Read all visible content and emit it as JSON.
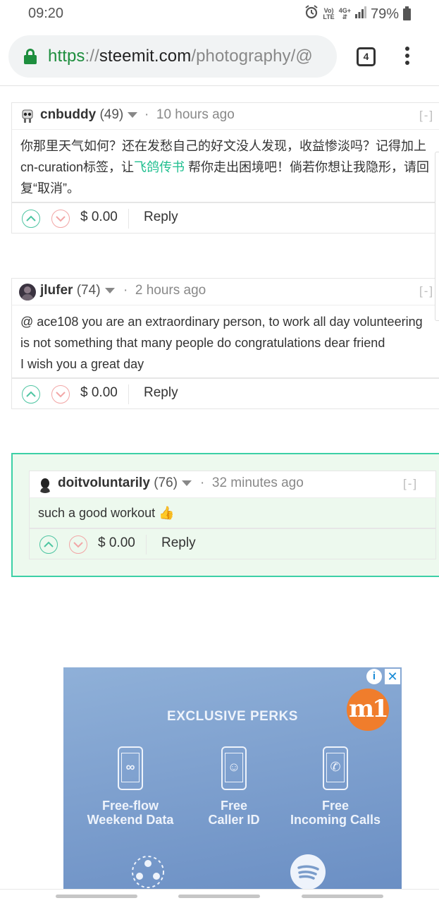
{
  "status_bar": {
    "time": "09:20",
    "network_top": "Vo)",
    "network_bottom": "LTE",
    "data_top": "4G+",
    "battery": "79%"
  },
  "browser": {
    "url_scheme": "https",
    "url_sep": "://",
    "url_host": "steemit.com",
    "url_path": "/photography/@",
    "tab_count": "4"
  },
  "comments": [
    {
      "author": "cnbuddy",
      "reputation": "(49)",
      "time": "10 hours ago",
      "collapse": "[-]",
      "body_before": "你那里天气如何？还在发愁自己的好文没人发现，收益惨淡吗？记得加上cn-curation标签，让",
      "body_link": "飞鸽传书",
      "body_after": " 帮你走出困境吧！倘若你想让我隐形，请回复“取消”。",
      "payout": "$ 0.00",
      "reply": "Reply"
    },
    {
      "author": "jlufer",
      "reputation": "(74)",
      "time": "2 hours ago",
      "collapse": "[-]",
      "body_line1": "@ ace108 you are an extraordinary person, to work all day volunteering",
      "body_line2": "is not something that many people do congratulations dear friend",
      "body_line3": "I wish you a great day",
      "payout": "$ 0.00",
      "reply": "Reply"
    },
    {
      "author": "doitvoluntarily",
      "reputation": "(76)",
      "time": "32 minutes ago",
      "collapse": "[-]",
      "body": "such a good workout 👍",
      "payout": "$ 0.00",
      "reply": "Reply"
    }
  ],
  "ad": {
    "title": "EXCLUSIVE PERKS",
    "logo": "m1",
    "info_icon": "i",
    "close_icon": "✕",
    "perks": [
      {
        "line1": "Free-flow",
        "line2": "Weekend Data",
        "glyph": "∞"
      },
      {
        "line1": "Free",
        "line2": "Caller ID",
        "glyph": "☺"
      },
      {
        "line1": "Free",
        "line2": "Incoming Calls",
        "glyph": "✆"
      }
    ]
  },
  "colors": {
    "accent_green": "#1fbf8f",
    "highlight_border": "#3cd0a6",
    "highlight_bg": "#edf9ee",
    "secure_green": "#1e8e3e",
    "ad_orange": "#f07d2c"
  }
}
